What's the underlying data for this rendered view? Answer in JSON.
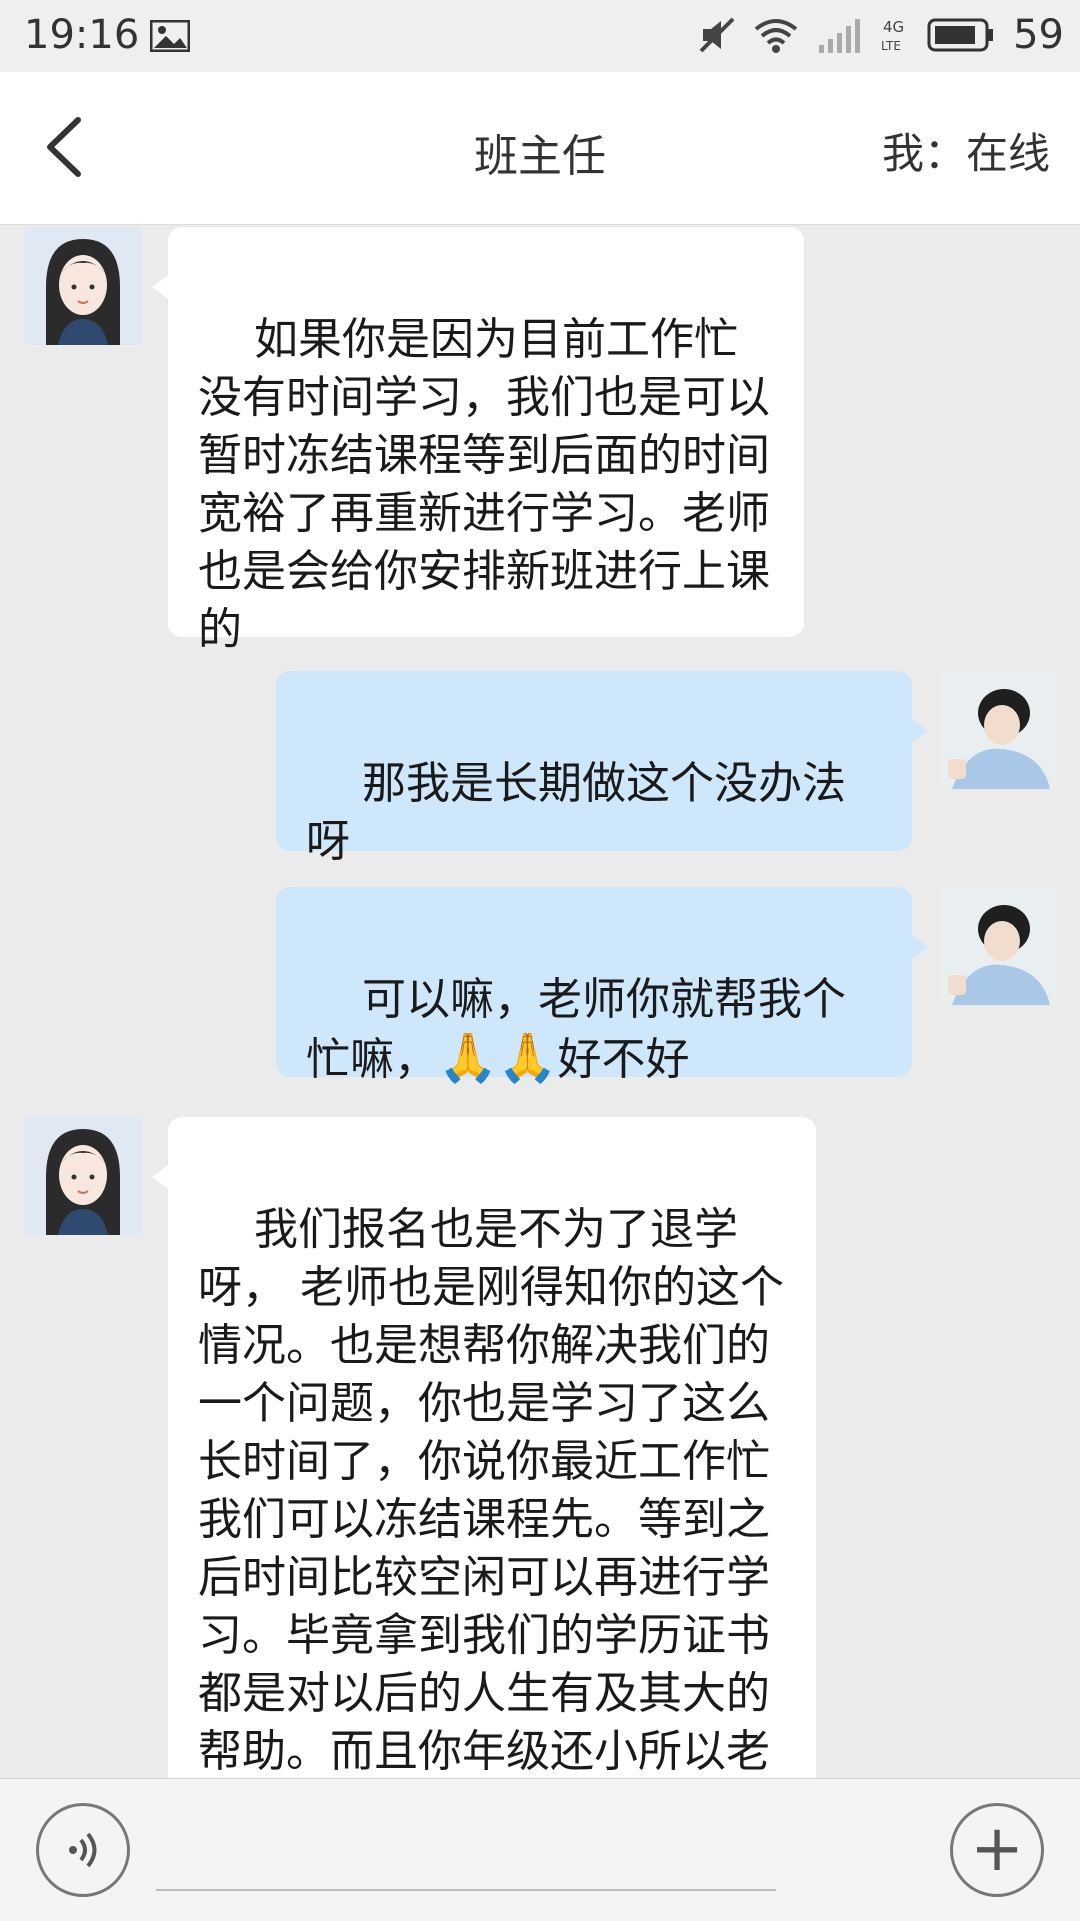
{
  "status_bar": {
    "time": "19:16",
    "battery": "59",
    "network": "4G LTE"
  },
  "header": {
    "title": "班主任",
    "online_status": "我：在线"
  },
  "messages": [
    {
      "from": "teacher",
      "text": "如果你是因为目前工作忙没有时间学习，我们也是可以暂时冻结课程等到后面的时间宽裕了再重新进行学习。老师也是会给你安排新班进行上课的"
    },
    {
      "from": "me",
      "text": "那我是长期做这个没办法呀",
      "emoji": "😭"
    },
    {
      "from": "me",
      "text_before": "可以嘛，老师你就帮我个忙嘛，",
      "emoji": "🙏🙏",
      "text_after": "好不好"
    },
    {
      "from": "teacher",
      "text": "我们报名也是不为了退学呀， 老师也是刚得知你的这个情况。也是想帮你解决我们的一个问题，你也是学习了这么长时间了，你说你最近工作忙我们可以冻结课程先。等到之后时间比较空闲可以再进行学习。毕竟拿到我们的学历证书都是对以后的人生有及其大的帮助。而且你年级还小所以老师不想"
    }
  ],
  "input_bar": {
    "plus_label": "+"
  },
  "colors": {
    "background": "#ebebeb",
    "incoming_bubble": "#ffffff",
    "outgoing_bubble": "#cfe7fb"
  }
}
